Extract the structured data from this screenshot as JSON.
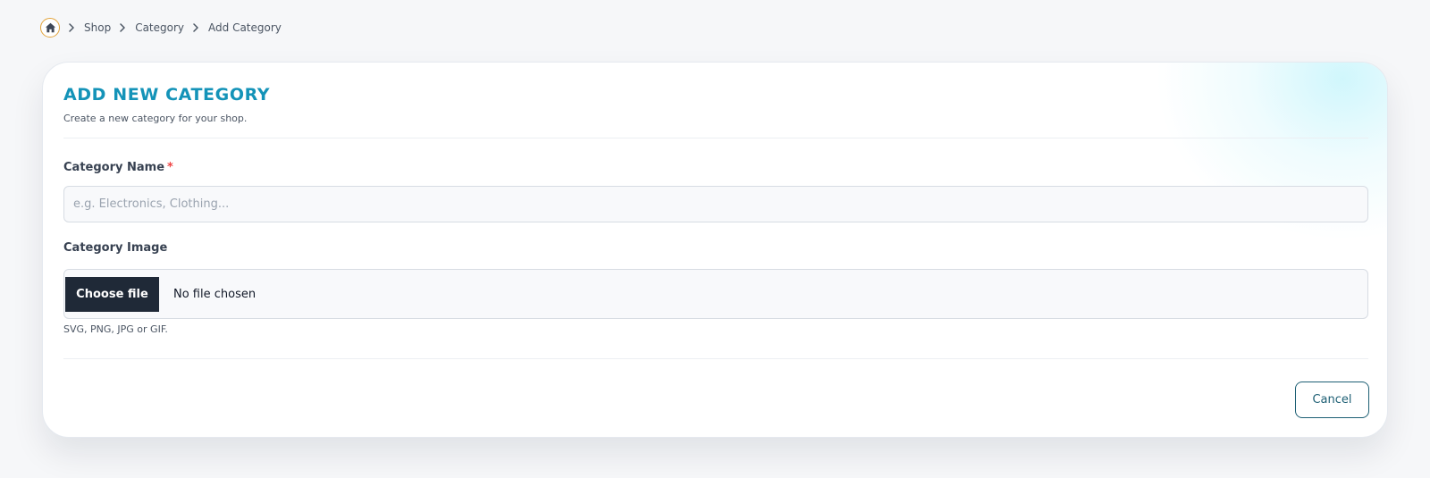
{
  "breadcrumb": {
    "home_icon": "home-icon",
    "items": [
      "Shop",
      "Category",
      "Add Category"
    ]
  },
  "form": {
    "title": "ADD NEW CATEGORY",
    "subtitle": "Create a new category for your shop.",
    "name_field": {
      "label": "Category Name",
      "required_marker": "*",
      "value": "",
      "placeholder": "e.g. Electronics, Clothing..."
    },
    "image_field": {
      "label": "Category Image",
      "button_label": "Choose file",
      "status": "No file chosen",
      "hint": "SVG, PNG, JPG or GIF."
    },
    "cancel_label": "Cancel"
  },
  "colors": {
    "accent": "#1493b8",
    "required": "#ef4444",
    "file_button": "#1f2937",
    "cancel_border": "#1d5f74",
    "home_ring": "#e2a33b"
  }
}
